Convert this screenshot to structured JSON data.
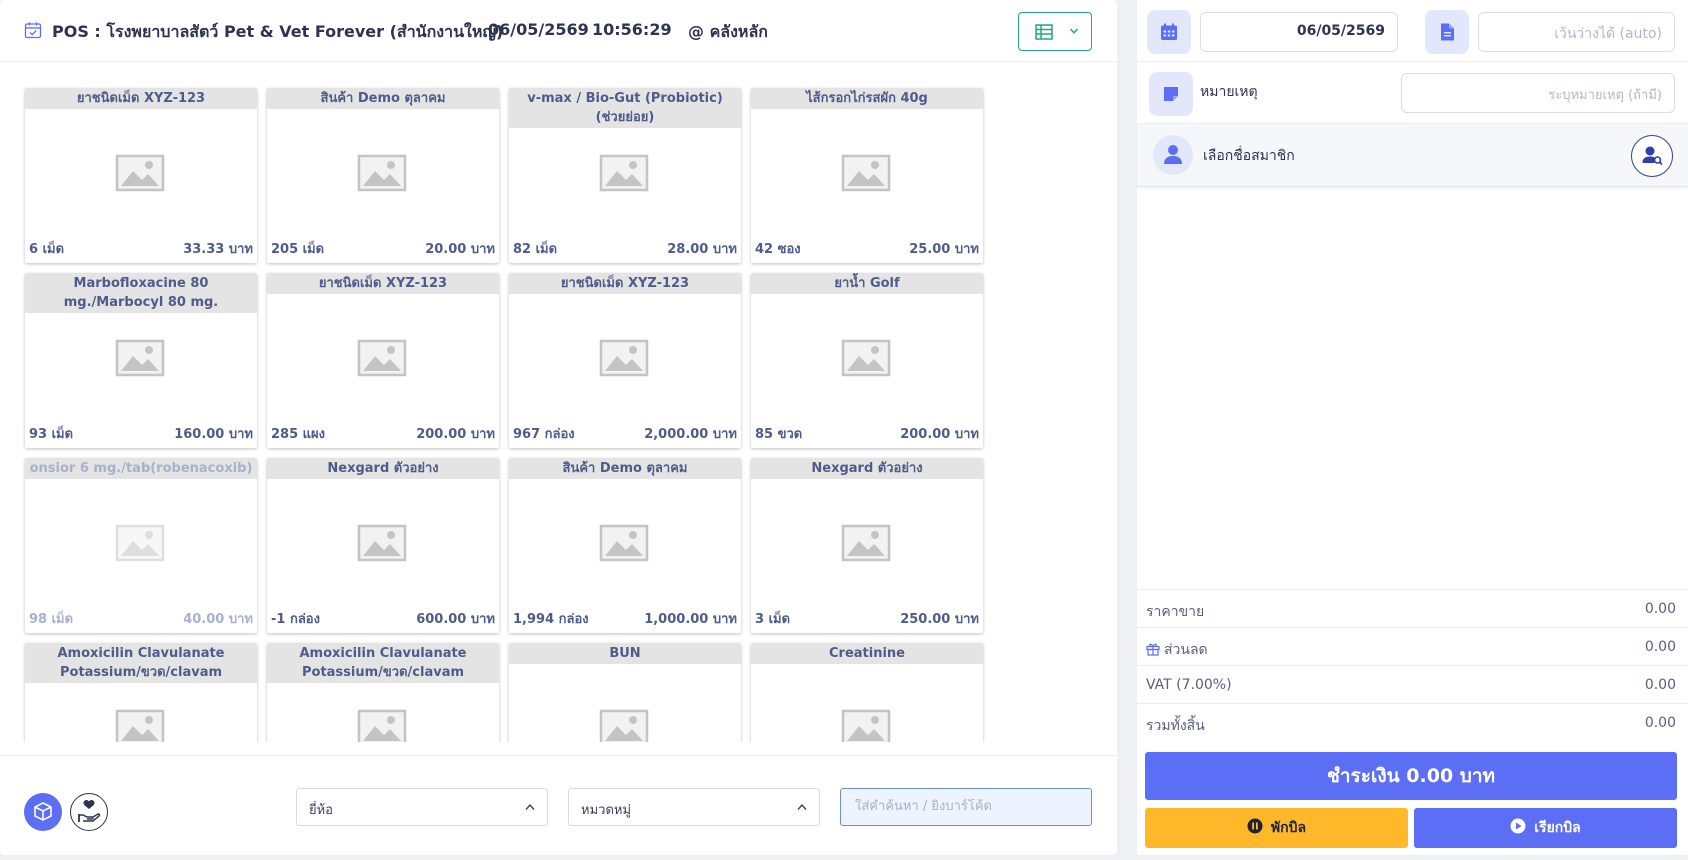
{
  "header": {
    "title": "POS : โรงพยาบาลสัตว์ Pet & Vet Forever (สำนักงานใหญ่)",
    "date": "06/05/2569",
    "time": "10:56:29",
    "branch": "@ คลังหลัก"
  },
  "products": [
    {
      "name": "ยาชนิดเม็ด XYZ-123",
      "qty": "6 เม็ด",
      "price": "33.33 บาท",
      "dim": false
    },
    {
      "name": "สินค้า Demo ตุลาคม",
      "qty": "205 เม็ด",
      "price": "20.00 บาท",
      "dim": false
    },
    {
      "name": "v-max / Bio-Gut (Probiotic) (ช่วยย่อย)",
      "qty": "82 เม็ด",
      "price": "28.00 บาท",
      "dim": false
    },
    {
      "name": "ไส้กรอกไก่รสผัก 40g",
      "qty": "42 ซอง",
      "price": "25.00 บาท",
      "dim": false
    },
    {
      "name": "Marbofloxacine 80 mg./Marbocyl 80 mg.",
      "qty": "93 เม็ด",
      "price": "160.00 บาท",
      "dim": false
    },
    {
      "name": "ยาชนิดเม็ด XYZ-123",
      "qty": "285 แผง",
      "price": "200.00 บาท",
      "dim": false
    },
    {
      "name": "ยาชนิดเม็ด XYZ-123",
      "qty": "967 กล่อง",
      "price": "2,000.00 บาท",
      "dim": false
    },
    {
      "name": "ยาน้ำ Golf",
      "qty": "85 ขวด",
      "price": "200.00 บาท",
      "dim": false
    },
    {
      "name": "onsior 6 mg./tab(robenacoxib)",
      "qty": "98 เม็ด",
      "price": "40.00 บาท",
      "dim": true
    },
    {
      "name": "Nexgard ตัวอย่าง",
      "qty": "-1 กล่อง",
      "price": "600.00 บาท",
      "dim": false
    },
    {
      "name": "สินค้า Demo ตุลาคม",
      "qty": "1,994 กล่อง",
      "price": "1,000.00 บาท",
      "dim": false
    },
    {
      "name": "Nexgard ตัวอย่าง",
      "qty": "3 เม็ด",
      "price": "250.00 บาท",
      "dim": false
    },
    {
      "name": "Amoxicilin Clavulanate Potassium/ขวด/clavam",
      "qty": "",
      "price": "",
      "dim": false
    },
    {
      "name": "Amoxicilin Clavulanate Potassium/ขวด/clavam",
      "qty": "",
      "price": "",
      "dim": false
    },
    {
      "name": "BUN",
      "qty": "",
      "price": "",
      "dim": false
    },
    {
      "name": "Creatinine",
      "qty": "",
      "price": "",
      "dim": false
    }
  ],
  "footer": {
    "brand_select": "ยี่ห้อ",
    "category_select": "หมวดหมู่",
    "search_placeholder": "ใส่คำค้นหา / ยิงบาร์โค้ด"
  },
  "right": {
    "doc_date": "06/05/2569",
    "doc_no_placeholder": "เว้นว่างได้ (auto)",
    "note_label": "หมายเหตุ",
    "note_placeholder": "ระบุหมายเหตุ (ถ้ามี)",
    "member_label": "เลือกชื่อสมาชิก",
    "summary": {
      "price_label": "ราคาขาย",
      "price_value": "0.00",
      "discount_label": "ส่วนลด",
      "discount_value": "0.00",
      "vat_label": "VAT (7.00%)",
      "vat_value": "0.00",
      "total_label": "รวมทั้งสิ้น",
      "total_value": "0.00"
    },
    "pay_button": "ชำระเงิน 0.00 บาท",
    "hold_button": "พักบิล",
    "recall_button": "เรียกบิล"
  },
  "colors": {
    "accent": "#5b6ef5",
    "hold": "#ffb829",
    "view_button_border": "#28a47e"
  },
  "icons": [
    "calendar-check-icon",
    "table-icon",
    "chevron-down-icon",
    "image-placeholder-icon",
    "box-icon",
    "hand-heart-icon",
    "calendar-icon",
    "document-icon",
    "note-icon",
    "user-icon",
    "user-search-icon",
    "gift-icon",
    "pause-icon",
    "play-icon"
  ]
}
